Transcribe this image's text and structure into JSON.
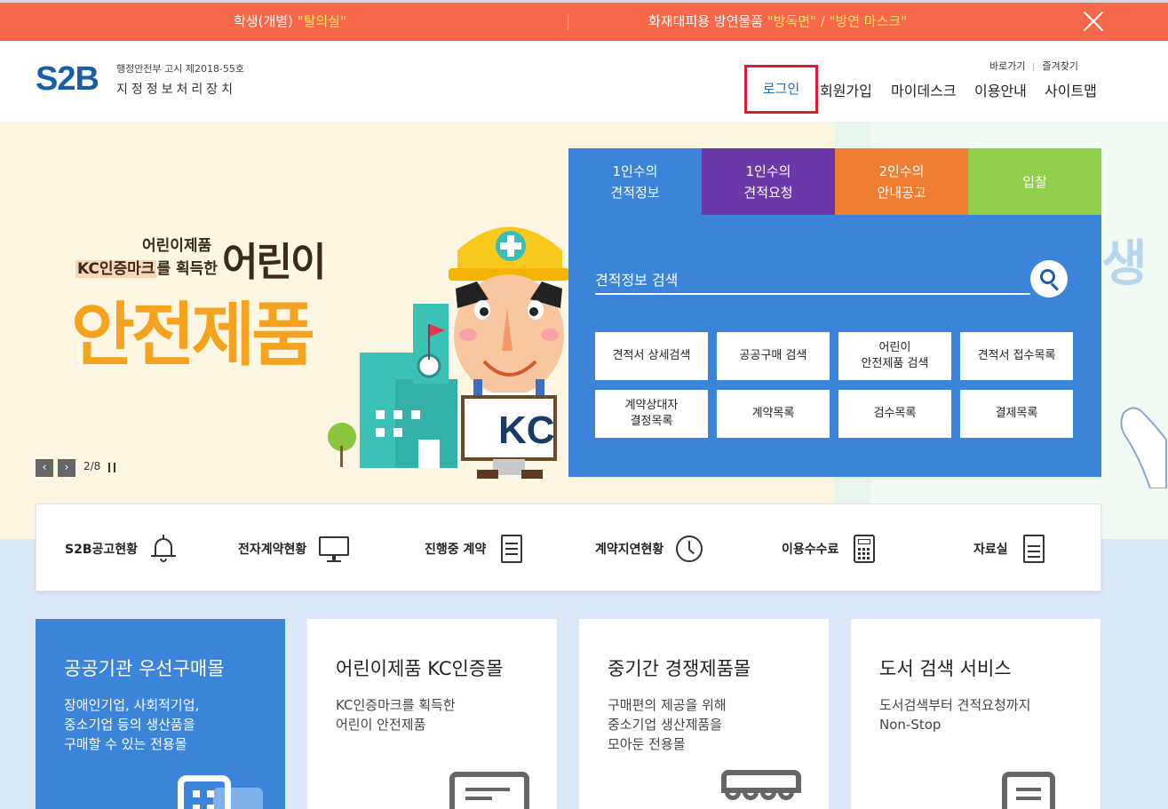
{
  "notice": {
    "item1_prefix": "학생(개별) ",
    "item1_highlight": "\"탈의실\"",
    "item2_prefix": "화재대피용 방연물품 ",
    "item2_highlight": "\"방독면\" / \"방연 마스크\""
  },
  "header": {
    "logo": "S2B",
    "logo_sub1": "행정안전부 고시 제2018-55호",
    "logo_sub2": "지정정보처리장치",
    "util_links": [
      "바로가기",
      "즐겨찾기"
    ],
    "gnb": {
      "login": "로그인",
      "join": "회원가입",
      "mydesk": "마이데스크",
      "guide": "이용안내",
      "sitemap": "사이트맵"
    }
  },
  "hero": {
    "sub1": "어린이제품",
    "sub2_mark": "KC인증마크",
    "sub2_rest": "를 획득한",
    "title_small": "어린이",
    "title_big": "안전제품",
    "page_indicator": "2/8",
    "peek_text": "생"
  },
  "panel": {
    "tabs": [
      "1인수의\n견적정보",
      "1인수의\n견적요청",
      "2인수의\n안내공고",
      "입찰"
    ],
    "search_placeholder": "견적정보 검색",
    "quick_buttons": [
      "견적서 상세검색",
      "공공구매 검색",
      "어린이\n안전제품 검색",
      "견적서 접수목록",
      "계약상대자\n결정목록",
      "계약목록",
      "검수목록",
      "결제목록"
    ]
  },
  "quickbar": {
    "items": [
      "S2B공고현황",
      "전자계약현황",
      "진행중 계약",
      "계약지연현황",
      "이용수수료",
      "자료실"
    ]
  },
  "cards": [
    {
      "title": "공공기관 우선구매몰",
      "desc": "장애인기업, 사회적기업,\n중소기업 등의 생산품을\n구매할 수 있는 전용몰"
    },
    {
      "title": "어린이제품 KC인증몰",
      "desc": "KC인증마크를 획득한\n어린이 안전제품"
    },
    {
      "title": "중기간 경쟁제품몰",
      "desc": "구매편의 제공을 위해\n중소기업 생산제품을\n모아둔 전용몰"
    },
    {
      "title": "도서 검색 서비스",
      "desc": "도서검색부터 견적요청까지\nNon-Stop"
    }
  ],
  "colors": {
    "notice_bg": "#f7684a",
    "brand_blue": "#1b5ea8",
    "panel_blue": "#3b84d9",
    "tab_purple": "#6a39a8",
    "tab_orange": "#ef7e31",
    "tab_green": "#8fcf4a",
    "login_highlight": "#d32030"
  }
}
